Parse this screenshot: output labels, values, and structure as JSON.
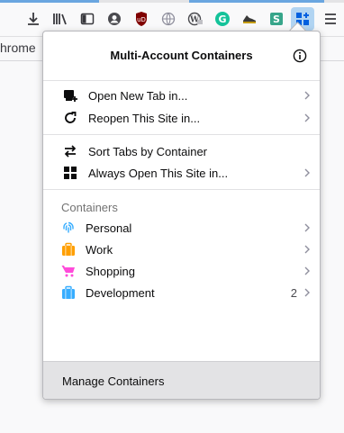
{
  "bookmarks_bar": {
    "visible_text": "hrome"
  },
  "toolbar": {
    "buttons": [
      {
        "name": "downloads-icon"
      },
      {
        "name": "library-icon"
      },
      {
        "name": "sidebar-icon"
      },
      {
        "name": "account-icon"
      },
      {
        "name": "ublock-icon",
        "badge": "uD"
      },
      {
        "name": "globe-icon"
      },
      {
        "name": "wordpress-icon"
      },
      {
        "name": "grammarly-icon",
        "letter": "G"
      },
      {
        "name": "shoe-icon"
      },
      {
        "name": "s-extension-icon",
        "letter": "S"
      },
      {
        "name": "containers-icon"
      },
      {
        "name": "menu-icon"
      }
    ]
  },
  "panel": {
    "title": "Multi-Account Containers",
    "actions": [
      {
        "label": "Open New Tab in...",
        "icon": "new-tab-icon",
        "has_arrow": true
      },
      {
        "label": "Reopen This Site in...",
        "icon": "reopen-icon",
        "has_arrow": true
      }
    ],
    "tools": [
      {
        "label": "Sort Tabs by Container",
        "icon": "sort-icon",
        "has_arrow": false
      },
      {
        "label": "Always Open This Site in...",
        "icon": "always-open-icon",
        "has_arrow": true
      }
    ],
    "containers_heading": "Containers",
    "containers": [
      {
        "label": "Personal",
        "icon": "fingerprint-icon",
        "color": "#37adff",
        "count": ""
      },
      {
        "label": "Work",
        "icon": "briefcase-icon",
        "color": "#ff9f00",
        "count": ""
      },
      {
        "label": "Shopping",
        "icon": "cart-icon",
        "color": "#ff4bda",
        "count": ""
      },
      {
        "label": "Development",
        "icon": "briefcase-icon",
        "color": "#37adff",
        "count": "2"
      }
    ],
    "footer_label": "Manage Containers"
  },
  "colors": {
    "accent": "#b1d4f2",
    "footer_bg": "#e3e3e5"
  }
}
